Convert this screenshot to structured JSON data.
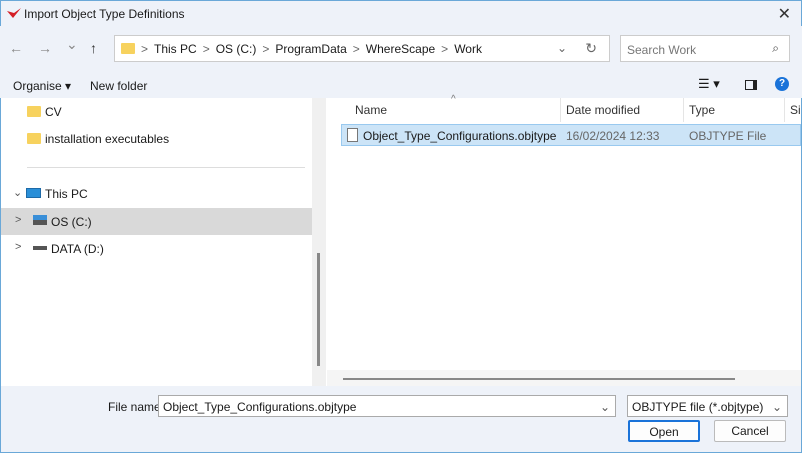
{
  "window": {
    "title": "Import Object Type Definitions",
    "close": "✕"
  },
  "nav": {
    "back": "←",
    "forward": "→",
    "recent": "⌄",
    "up": "↑",
    "breadcrumbs": [
      "This PC",
      "OS (C:)",
      "ProgramData",
      "WhereScape",
      "Work"
    ],
    "separator": ">",
    "dropdown": "⌄",
    "refresh": "↻",
    "search_placeholder": "Search Work",
    "search_icon": "⌕"
  },
  "toolbar": {
    "organise": "Organise ▾",
    "new_folder": "New folder",
    "view_icon": "☰ ▾",
    "help": "?"
  },
  "tree": {
    "items": [
      {
        "label": "CV",
        "icon": "folder-icon"
      },
      {
        "label": "installation executables",
        "icon": "folder-icon"
      },
      {
        "label": "This PC",
        "icon": "pc-icon",
        "chevron": "⌄"
      },
      {
        "label": "OS (C:)",
        "icon": "drive-icon",
        "chevron": ">",
        "selected": true
      },
      {
        "label": "DATA (D:)",
        "icon": "drive-icon",
        "chevron": ">"
      }
    ]
  },
  "files": {
    "sort_indicator": "^",
    "columns": [
      "Name",
      "Date modified",
      "Type",
      "Size"
    ],
    "rows": [
      {
        "name": "Object_Type_Configurations.objtype",
        "date": "16/02/2024 12:33",
        "type": "OBJTYPE File",
        "selected": true
      }
    ]
  },
  "footer": {
    "file_name_label": "File name:",
    "file_name_value": "Object_Type_Configurations.objtype",
    "file_type": "OBJTYPE file (*.objtype)",
    "dropdown": "⌄",
    "open": "Open",
    "cancel": "Cancel"
  },
  "colors": {
    "accent": "#1a73d9",
    "selection": "#cce4f7",
    "chrome": "#eef2f9"
  }
}
